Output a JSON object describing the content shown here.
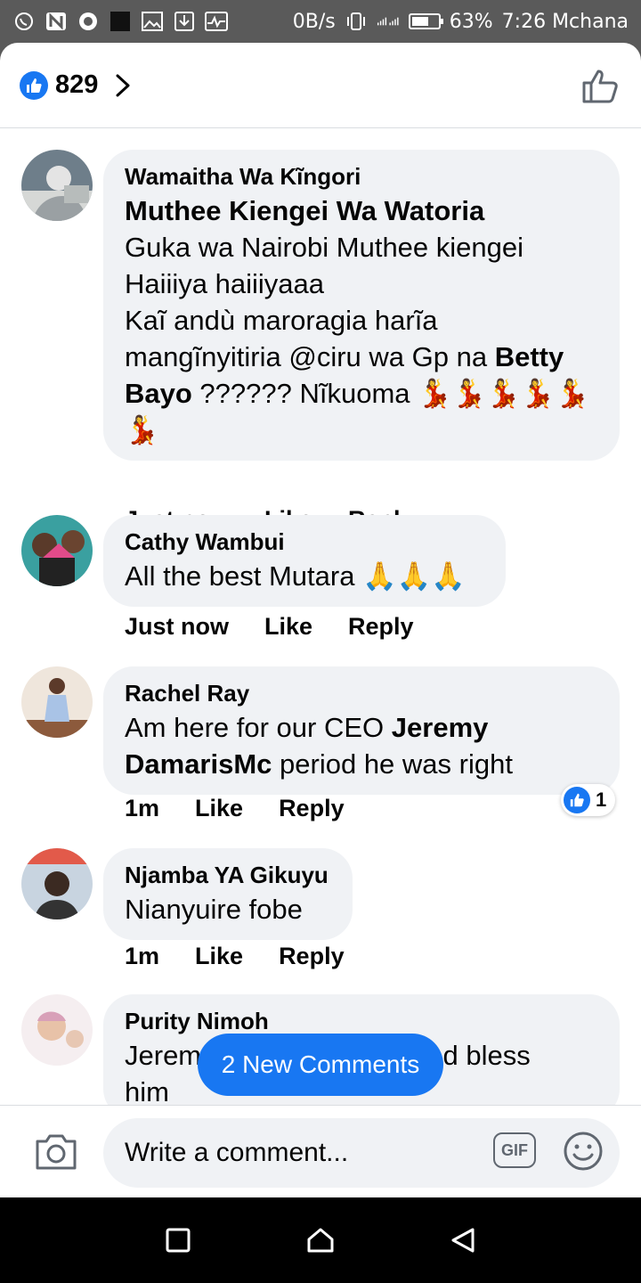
{
  "status_bar": {
    "speed": "0B/s",
    "battery": "63%",
    "battery_level": 0.63,
    "time": "7:26 Mchana"
  },
  "header": {
    "like_count": "829"
  },
  "comments": [
    {
      "name": "Wamaitha Wa Kĩngori",
      "lines": [
        {
          "bold": "Muthee Kiengei Wa Watoria"
        },
        {
          "text": "Guka wa Nairobi Muthee kiengei"
        },
        {
          "text": "Haiiiya haiiiyaaa"
        },
        {
          "text": "Kaĩ andù maroragia harĩa"
        },
        {
          "pre": "mangĩnyitiria @ciru wa Gp na ",
          "bold": "Betty"
        },
        {
          "bold": "Bayo",
          "post": " ?????? Nĩkuoma 💃💃💃💃💃"
        },
        {
          "text": "💃"
        }
      ],
      "time": "Just now",
      "like": "Like",
      "reply": "Reply"
    },
    {
      "name": "Cathy Wambui",
      "text": "All the best Mutara 🙏🙏🙏",
      "time": "Just now",
      "like": "Like",
      "reply": "Reply"
    },
    {
      "name": "Rachel Ray",
      "pre": "Am here for our CEO ",
      "bold1": "Jeremy",
      "bold2": "DamarisMc",
      "post": " period he was right",
      "time": "1m",
      "like": "Like",
      "reply": "Reply",
      "reactions": "1"
    },
    {
      "name": "Njamba YA Gikuyu",
      "text": "Nianyuire fobe",
      "time": "1m",
      "like": "Like",
      "reply": "Reply"
    },
    {
      "name": "Purity Nimoh",
      "line1_pre": "Jerem",
      "line1_post": "God bless",
      "line2": "him"
    }
  ],
  "new_comments": "2 New Comments",
  "composer": {
    "placeholder": "Write a comment...",
    "gif": "GIF"
  },
  "colors": {
    "accent": "#1877f2",
    "bubble": "#f0f2f5",
    "status_bar": "#5a5a5a"
  }
}
